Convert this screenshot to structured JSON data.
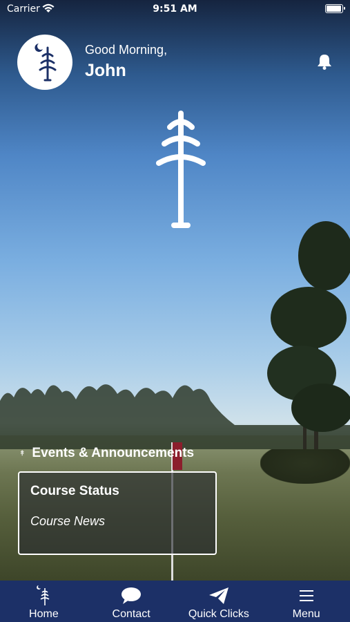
{
  "status_bar": {
    "carrier": "Carrier",
    "time": "9:51 AM",
    "battery_level": 0.95
  },
  "header": {
    "greeting": "Good Morning,",
    "user_name": "John"
  },
  "section": {
    "title": "Events & Announcements"
  },
  "card": {
    "title": "Course Status",
    "subtitle": "Course News"
  },
  "tabs": [
    {
      "label": "Home",
      "icon": "pine-moon-icon"
    },
    {
      "label": "Contact",
      "icon": "chat-bubble-icon"
    },
    {
      "label": "Quick Clicks",
      "icon": "paper-plane-icon"
    },
    {
      "label": "Menu",
      "icon": "hamburger-menu-icon"
    }
  ],
  "colors": {
    "tab_bar": "#1c3067",
    "brand_navy": "#1c3067",
    "card_border": "#ffffff"
  }
}
